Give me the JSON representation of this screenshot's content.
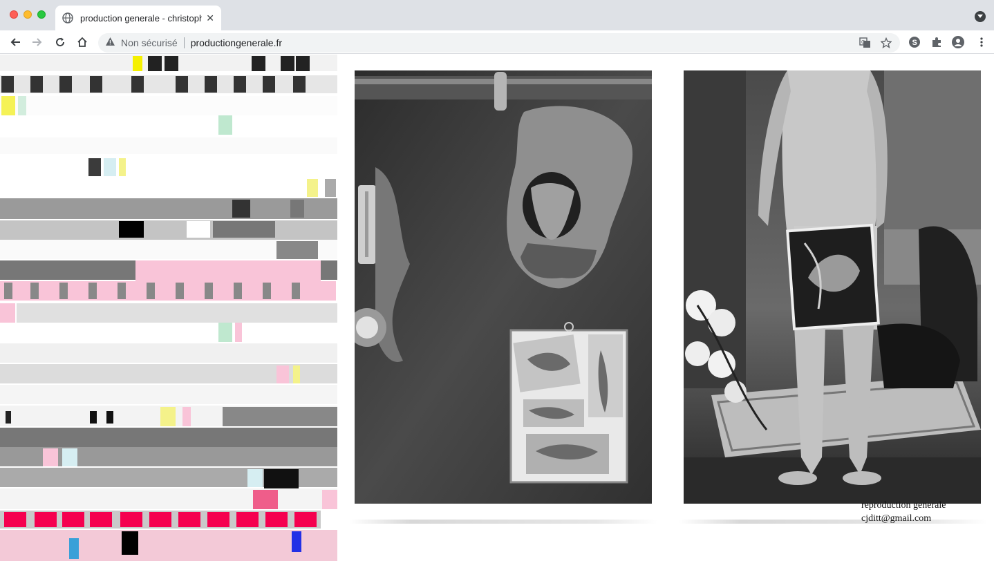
{
  "browser": {
    "tab_title": "production generale - christophe jacquet dit",
    "close_symbol": "✕",
    "security_label": "Non sécurisé",
    "url": "productiongenerale.fr"
  },
  "page": {
    "caption_line1": "reproduction generale",
    "caption_line2": "cjditt@gmail.com"
  },
  "colors": {
    "pink_strip": "#f9c4d8",
    "magenta_blocks": "#f5004f",
    "yellow_note": "#f4f28a",
    "mint_note": "#bfe8cf"
  }
}
